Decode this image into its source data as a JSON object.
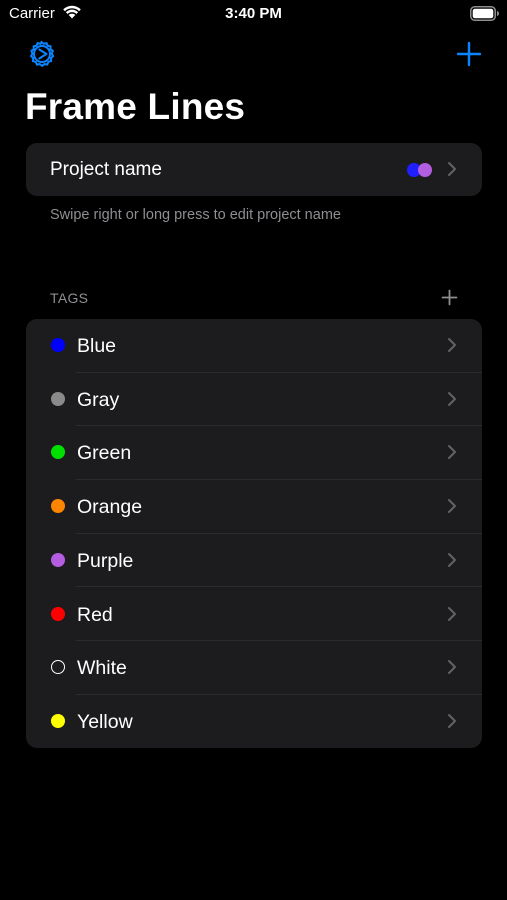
{
  "status_bar": {
    "carrier": "Carrier",
    "time": "3:40 PM",
    "icons": [
      "wifi-icon",
      "battery-icon"
    ]
  },
  "nav": {
    "settings_icon": "gear-icon",
    "add_icon": "plus-icon",
    "title": "Frame Lines"
  },
  "project": {
    "label": "Project name",
    "dot_colors": [
      "#1f1fff",
      "#b25ee0"
    ],
    "hint": "Swipe right or long press to edit project name"
  },
  "tags": {
    "header": "TAGS",
    "items": [
      {
        "label": "Blue",
        "color": "#0000ff"
      },
      {
        "label": "Gray",
        "color": "#8a8a8a"
      },
      {
        "label": "Green",
        "color": "#00e000"
      },
      {
        "label": "Orange",
        "color": "#ff8400"
      },
      {
        "label": "Purple",
        "color": "#b45de0"
      },
      {
        "label": "Red",
        "color": "#ff0000"
      },
      {
        "label": "White",
        "color": "#ffffff",
        "outline": true
      },
      {
        "label": "Yellow",
        "color": "#ffff00"
      }
    ]
  },
  "colors": {
    "accent": "#0a84ff",
    "card_background": "#1c1c1e",
    "secondary_text": "#8e8e93",
    "chevron": "#636366"
  }
}
